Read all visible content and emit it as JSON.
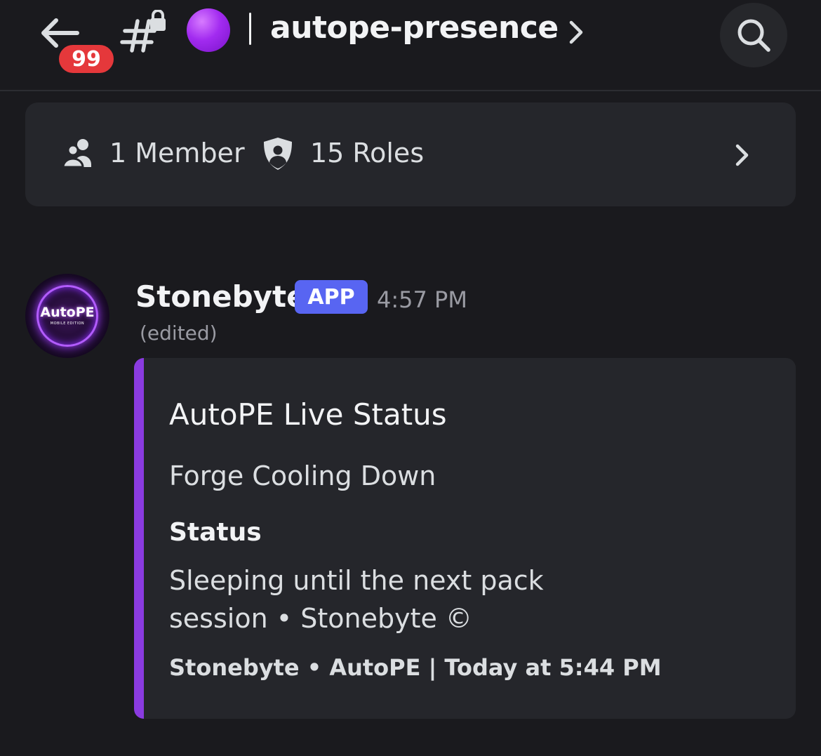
{
  "header": {
    "unread_count": "99",
    "channel_name": "autope-presence"
  },
  "info_bar": {
    "members_label": "1 Member",
    "roles_label": "15 Roles"
  },
  "message": {
    "avatar_text": "AutoPE",
    "avatar_subtext": "MOBILE EDITION",
    "author": "Stonebyte",
    "app_tag": "APP",
    "timestamp": "4:57 PM",
    "edited_label": "(edited)",
    "embed": {
      "accent_color": "#8a3be0",
      "title": "AutoPE Live Status",
      "description": "Forge Cooling Down",
      "field_name": "Status",
      "field_value": "Sleeping until the next pack session • Stonebyte ©",
      "footer": "Stonebyte • AutoPE | Today at 5:44 PM"
    }
  },
  "colors": {
    "background": "#1a1a1e",
    "badge_red": "#e5383b",
    "app_tag_blurple": "#5865f2",
    "status_dot_purple": "#a22bf0"
  },
  "icons": [
    "back-arrow-icon",
    "hash-lock-icon",
    "purple-circle-icon",
    "chevron-right-icon",
    "search-icon",
    "members-icon",
    "shield-icon"
  ]
}
